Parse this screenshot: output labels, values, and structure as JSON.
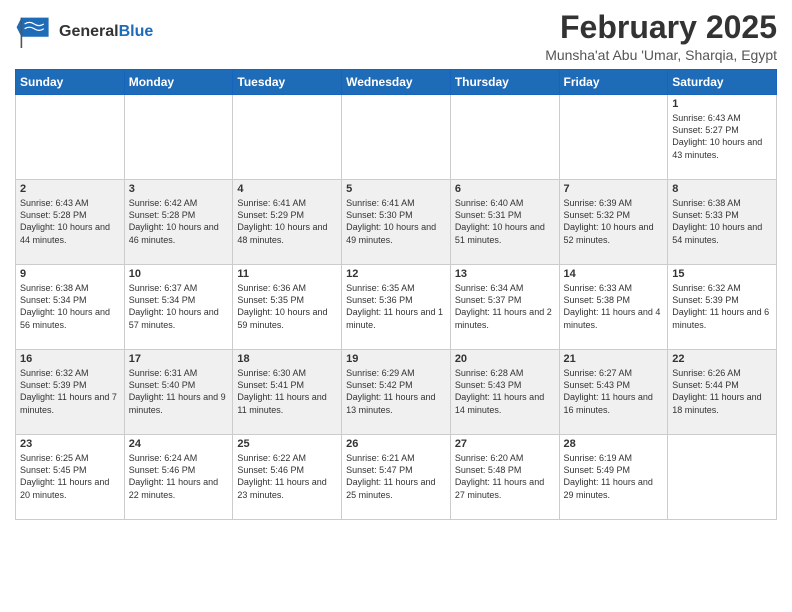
{
  "header": {
    "logo_general": "General",
    "logo_blue": "Blue",
    "month_title": "February 2025",
    "subtitle": "Munsha'at Abu 'Umar, Sharqia, Egypt"
  },
  "days_of_week": [
    "Sunday",
    "Monday",
    "Tuesday",
    "Wednesday",
    "Thursday",
    "Friday",
    "Saturday"
  ],
  "weeks": [
    [
      {
        "day": "",
        "info": ""
      },
      {
        "day": "",
        "info": ""
      },
      {
        "day": "",
        "info": ""
      },
      {
        "day": "",
        "info": ""
      },
      {
        "day": "",
        "info": ""
      },
      {
        "day": "",
        "info": ""
      },
      {
        "day": "1",
        "info": "Sunrise: 6:43 AM\nSunset: 5:27 PM\nDaylight: 10 hours and 43 minutes."
      }
    ],
    [
      {
        "day": "2",
        "info": "Sunrise: 6:43 AM\nSunset: 5:28 PM\nDaylight: 10 hours and 44 minutes."
      },
      {
        "day": "3",
        "info": "Sunrise: 6:42 AM\nSunset: 5:28 PM\nDaylight: 10 hours and 46 minutes."
      },
      {
        "day": "4",
        "info": "Sunrise: 6:41 AM\nSunset: 5:29 PM\nDaylight: 10 hours and 48 minutes."
      },
      {
        "day": "5",
        "info": "Sunrise: 6:41 AM\nSunset: 5:30 PM\nDaylight: 10 hours and 49 minutes."
      },
      {
        "day": "6",
        "info": "Sunrise: 6:40 AM\nSunset: 5:31 PM\nDaylight: 10 hours and 51 minutes."
      },
      {
        "day": "7",
        "info": "Sunrise: 6:39 AM\nSunset: 5:32 PM\nDaylight: 10 hours and 52 minutes."
      },
      {
        "day": "8",
        "info": "Sunrise: 6:38 AM\nSunset: 5:33 PM\nDaylight: 10 hours and 54 minutes."
      }
    ],
    [
      {
        "day": "9",
        "info": "Sunrise: 6:38 AM\nSunset: 5:34 PM\nDaylight: 10 hours and 56 minutes."
      },
      {
        "day": "10",
        "info": "Sunrise: 6:37 AM\nSunset: 5:34 PM\nDaylight: 10 hours and 57 minutes."
      },
      {
        "day": "11",
        "info": "Sunrise: 6:36 AM\nSunset: 5:35 PM\nDaylight: 10 hours and 59 minutes."
      },
      {
        "day": "12",
        "info": "Sunrise: 6:35 AM\nSunset: 5:36 PM\nDaylight: 11 hours and 1 minute."
      },
      {
        "day": "13",
        "info": "Sunrise: 6:34 AM\nSunset: 5:37 PM\nDaylight: 11 hours and 2 minutes."
      },
      {
        "day": "14",
        "info": "Sunrise: 6:33 AM\nSunset: 5:38 PM\nDaylight: 11 hours and 4 minutes."
      },
      {
        "day": "15",
        "info": "Sunrise: 6:32 AM\nSunset: 5:39 PM\nDaylight: 11 hours and 6 minutes."
      }
    ],
    [
      {
        "day": "16",
        "info": "Sunrise: 6:32 AM\nSunset: 5:39 PM\nDaylight: 11 hours and 7 minutes."
      },
      {
        "day": "17",
        "info": "Sunrise: 6:31 AM\nSunset: 5:40 PM\nDaylight: 11 hours and 9 minutes."
      },
      {
        "day": "18",
        "info": "Sunrise: 6:30 AM\nSunset: 5:41 PM\nDaylight: 11 hours and 11 minutes."
      },
      {
        "day": "19",
        "info": "Sunrise: 6:29 AM\nSunset: 5:42 PM\nDaylight: 11 hours and 13 minutes."
      },
      {
        "day": "20",
        "info": "Sunrise: 6:28 AM\nSunset: 5:43 PM\nDaylight: 11 hours and 14 minutes."
      },
      {
        "day": "21",
        "info": "Sunrise: 6:27 AM\nSunset: 5:43 PM\nDaylight: 11 hours and 16 minutes."
      },
      {
        "day": "22",
        "info": "Sunrise: 6:26 AM\nSunset: 5:44 PM\nDaylight: 11 hours and 18 minutes."
      }
    ],
    [
      {
        "day": "23",
        "info": "Sunrise: 6:25 AM\nSunset: 5:45 PM\nDaylight: 11 hours and 20 minutes."
      },
      {
        "day": "24",
        "info": "Sunrise: 6:24 AM\nSunset: 5:46 PM\nDaylight: 11 hours and 22 minutes."
      },
      {
        "day": "25",
        "info": "Sunrise: 6:22 AM\nSunset: 5:46 PM\nDaylight: 11 hours and 23 minutes."
      },
      {
        "day": "26",
        "info": "Sunrise: 6:21 AM\nSunset: 5:47 PM\nDaylight: 11 hours and 25 minutes."
      },
      {
        "day": "27",
        "info": "Sunrise: 6:20 AM\nSunset: 5:48 PM\nDaylight: 11 hours and 27 minutes."
      },
      {
        "day": "28",
        "info": "Sunrise: 6:19 AM\nSunset: 5:49 PM\nDaylight: 11 hours and 29 minutes."
      },
      {
        "day": "",
        "info": ""
      }
    ]
  ]
}
